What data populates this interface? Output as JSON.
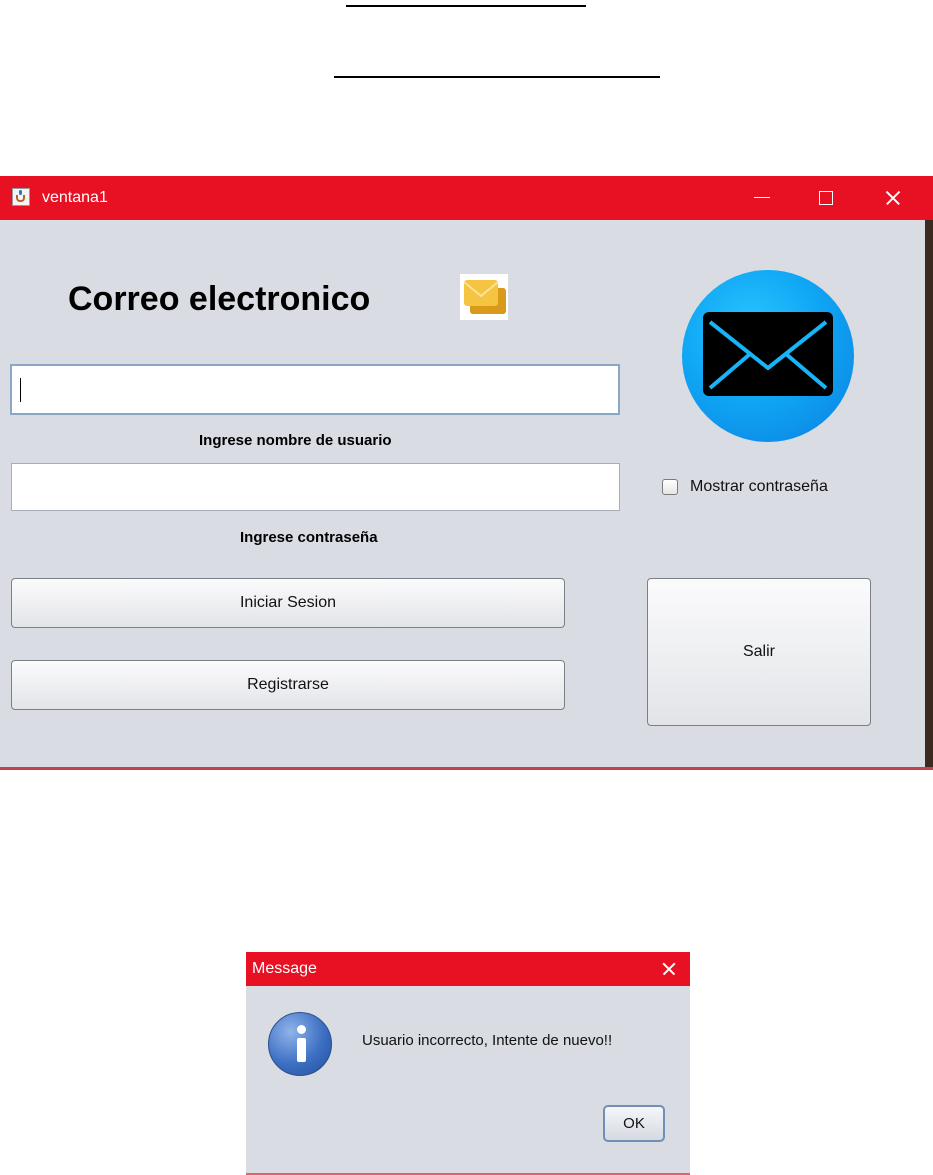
{
  "window": {
    "title": "ventana1",
    "accent_color": "#e81123"
  },
  "form": {
    "heading": "Correo electronico",
    "username": {
      "value": "",
      "label": "Ingrese nombre de usuario"
    },
    "password": {
      "value": "",
      "label": "Ingrese contraseña"
    },
    "show_password": {
      "label": "Mostrar contraseña",
      "checked": false
    },
    "buttons": {
      "login": "Iniciar Sesion",
      "register": "Registrarse",
      "exit": "Salir"
    },
    "icons": {
      "small": "mail-stack-icon",
      "large": "envelope-circle-icon"
    }
  },
  "dialog": {
    "title": "Message",
    "message": "Usuario incorrecto, Intente de nuevo!!",
    "ok_label": "OK",
    "icon": "info-icon"
  }
}
